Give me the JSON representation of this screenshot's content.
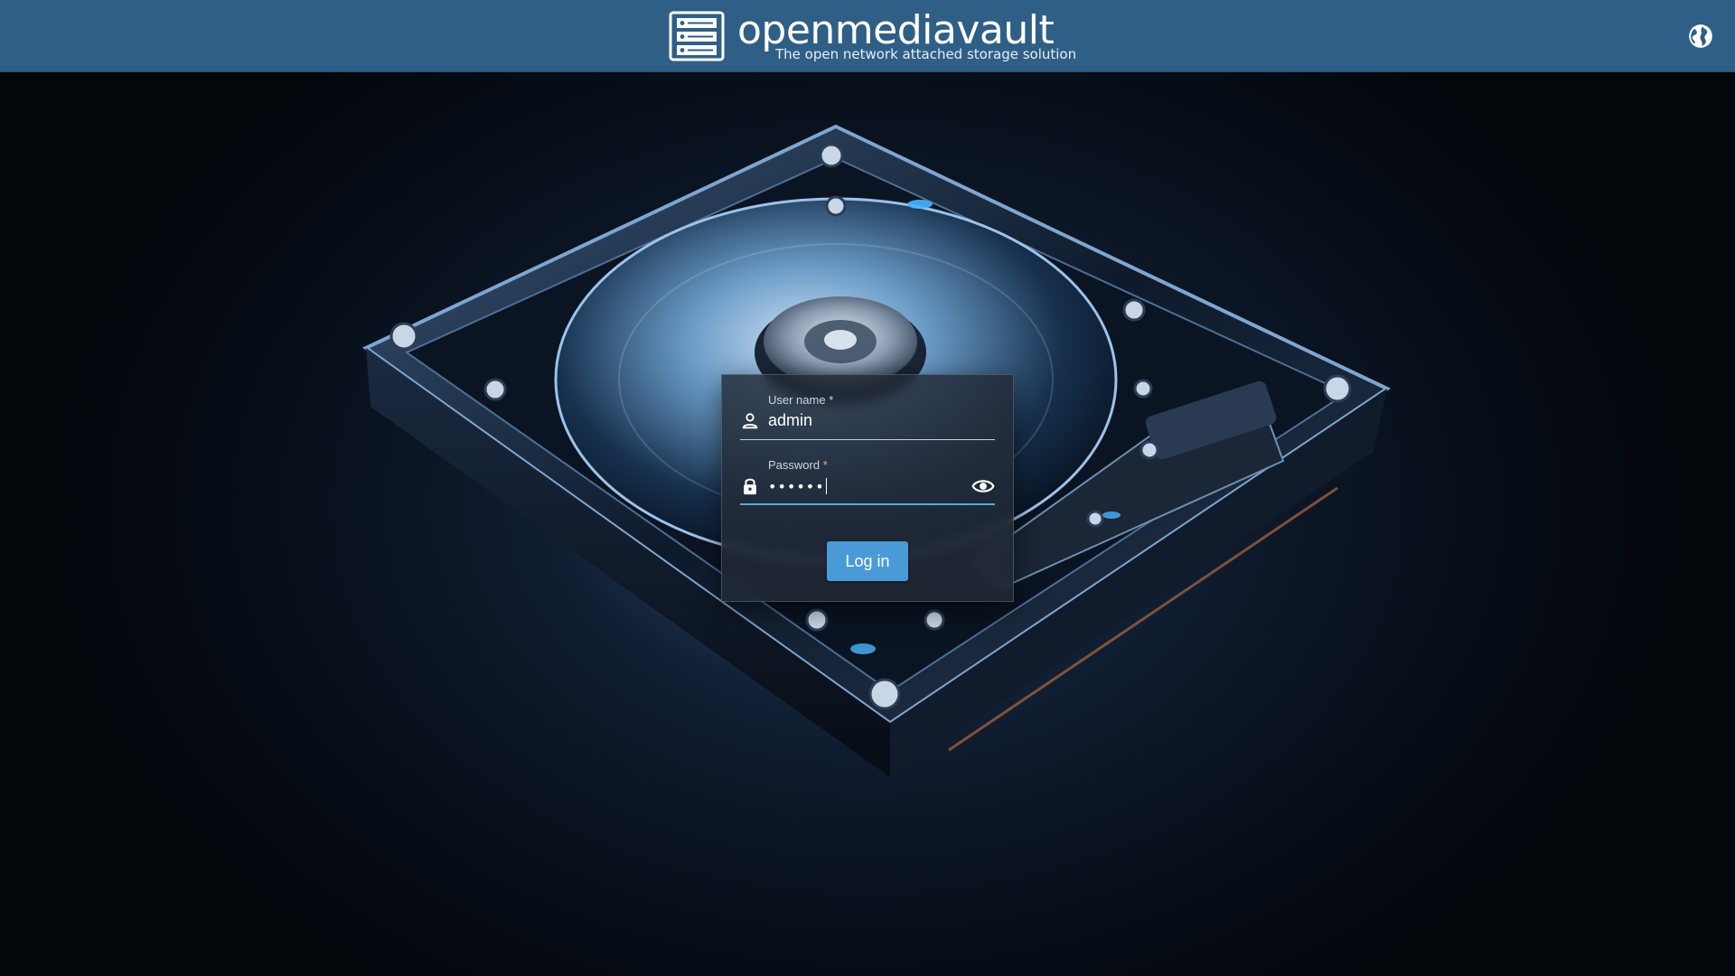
{
  "header": {
    "brand_name": "openmediavault",
    "tagline": "The open network attached storage solution",
    "language_icon": "globe-icon"
  },
  "login": {
    "username": {
      "label": "User name",
      "required_marker": "*",
      "value": "admin",
      "icon": "user-icon"
    },
    "password": {
      "label": "Password",
      "required_marker": "*",
      "masked_value": "••••••",
      "icon": "lock-icon",
      "toggle_icon": "eye-icon"
    },
    "submit_label": "Log in"
  },
  "colors": {
    "header_bg": "#2f5f86",
    "accent": "#4b9ad8",
    "required_password_marker": "#e6b84a"
  }
}
